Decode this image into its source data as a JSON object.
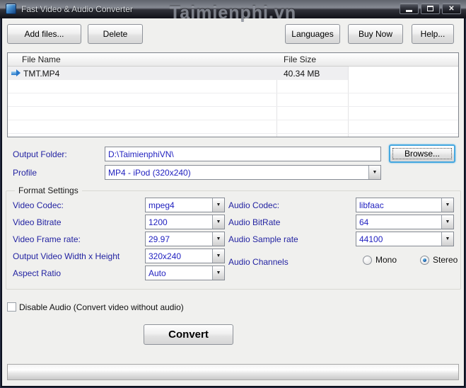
{
  "window": {
    "title": "Fast Video & Audio Converter",
    "watermark": "Taimienphi.vn"
  },
  "icons": {
    "close_glyph": "✕",
    "dropdown_glyph": "▼"
  },
  "toolbar": {
    "add_files": "Add files...",
    "delete": "Delete",
    "languages": "Languages",
    "buy_now": "Buy Now",
    "help": "Help..."
  },
  "file_list": {
    "columns": [
      "File Name",
      "File Size"
    ],
    "rows": [
      {
        "name": "TMT.MP4",
        "size": "40.34 MB"
      }
    ]
  },
  "output_folder": {
    "label": "Output Folder:",
    "value": "D:\\TaimienphiVN\\",
    "browse": "Browse..."
  },
  "profile": {
    "label": "Profile",
    "value": "MP4 - iPod (320x240)"
  },
  "format_settings": {
    "title": "Format Settings",
    "video_codec": {
      "label": "Video Codec:",
      "value": "mpeg4"
    },
    "video_bitrate": {
      "label": "Video Bitrate",
      "value": "1200"
    },
    "video_frame_rate": {
      "label": "Video Frame rate:",
      "value": "29.97"
    },
    "output_size": {
      "label": "Output Video Width x Height",
      "value": "320x240"
    },
    "aspect_ratio": {
      "label": "Aspect Ratio",
      "value": "Auto"
    },
    "audio_codec": {
      "label": "Audio Codec:",
      "value": "libfaac"
    },
    "audio_bitrate": {
      "label": "Audio BitRate",
      "value": "64"
    },
    "audio_sample_rate": {
      "label": "Audio Sample rate",
      "value": "44100"
    },
    "audio_channels": {
      "label": "Audio Channels",
      "options": [
        "Mono",
        "Stereo"
      ],
      "selected": "Stereo"
    }
  },
  "disable_audio": {
    "label": "Disable Audio (Convert video without audio)",
    "checked": false
  },
  "convert_label": "Convert",
  "colors": {
    "label_navy": "#2323a2",
    "value_blue": "#2222c0",
    "selection_bg": "#efeff1",
    "focus_blue": "#45a8e0"
  }
}
